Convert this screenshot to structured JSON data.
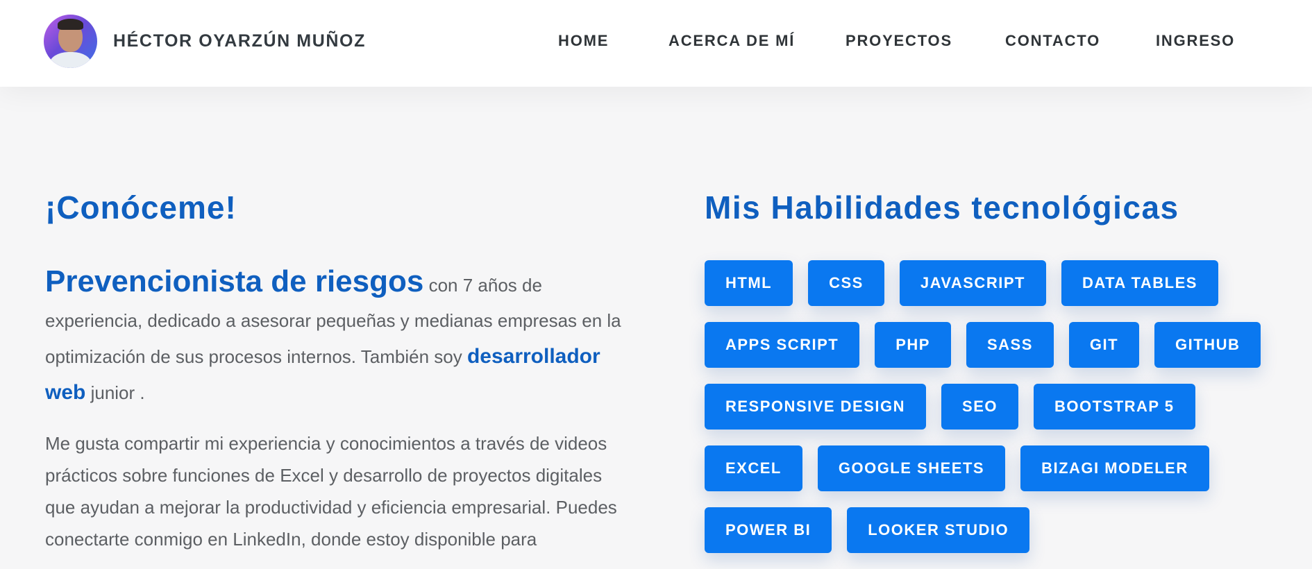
{
  "header": {
    "brand_name": "HÉCTOR OYARZÚN MUÑOZ",
    "nav": [
      {
        "label": "HOME"
      },
      {
        "label": "ACERCA DE MÍ"
      },
      {
        "label": "PROYECTOS"
      },
      {
        "label": "CONTACTO"
      },
      {
        "label": "INGRESO"
      }
    ]
  },
  "about": {
    "title": "¡Conóceme!",
    "lead": "Prevencionista de riesgos",
    "text_1": " con 7 años de experiencia, dedicado a asesorar pequeñas y medianas empresas en la optimización de sus procesos internos. También soy ",
    "role": "desarrollador web",
    "text_2": " junior .",
    "paragraph_2": "Me gusta compartir mi experiencia y conocimientos a través de videos prácticos sobre funciones de Excel y desarrollo de proyectos digitales que ayudan a mejorar la productividad y eficiencia empresarial. Puedes conectarte conmigo en LinkedIn, donde estoy disponible para"
  },
  "skills": {
    "title": "Mis Habilidades tecnológicas",
    "rows": [
      [
        "HTML",
        "CSS",
        "JAVASCRIPT",
        "DATA TABLES"
      ],
      [
        "APPS SCRIPT",
        "PHP",
        "SASS",
        "GIT",
        "GITHUB"
      ],
      [
        "RESPONSIVE DESIGN",
        "SEO",
        "BOOTSTRAP 5"
      ],
      [
        "EXCEL",
        "GOOGLE SHEETS",
        "BIZAGI MODELER"
      ],
      [
        "POWER BI",
        "LOOKER STUDIO"
      ]
    ]
  },
  "colors": {
    "accent": "#0f5fbf",
    "skill_badge": "#0a78f0",
    "background": "#f6f6f7"
  }
}
